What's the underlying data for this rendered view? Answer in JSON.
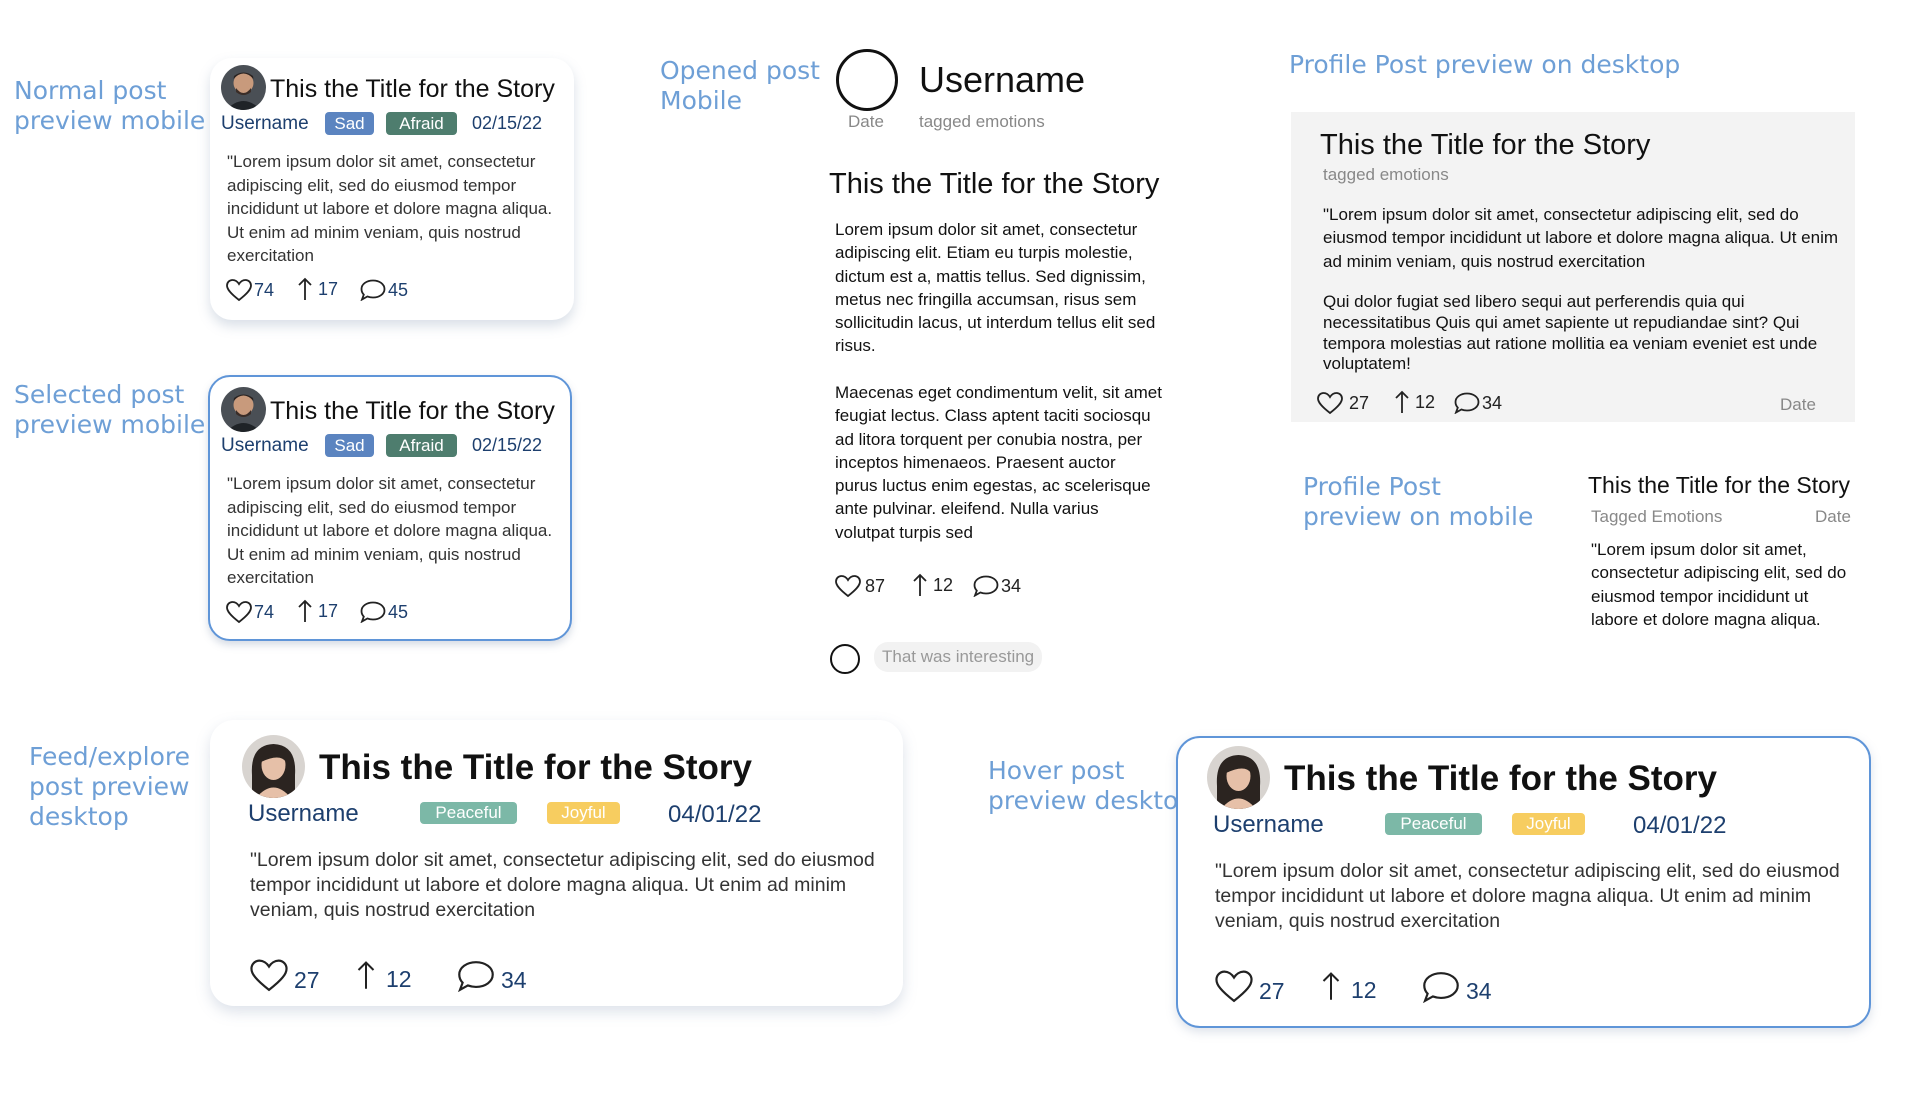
{
  "labels": {
    "normal": [
      "Normal post",
      "preview mobile"
    ],
    "selected": [
      "Selected post",
      "preview mobile"
    ],
    "feed": [
      "Feed/explore",
      "post preview",
      "desktop"
    ],
    "opened": [
      "Opened post",
      "Mobile"
    ],
    "profile_desktop": "Profile Post preview on desktop",
    "profile_mobile": [
      "Profile Post",
      "preview on mobile"
    ],
    "hover": [
      "Hover post",
      "preview desktop"
    ]
  },
  "mobile_post": {
    "title": "This the Title for the Story",
    "username": "Username",
    "tags": [
      "Sad",
      "Afraid"
    ],
    "date": "02/15/22",
    "body": "\"Lorem ipsum dolor sit amet, consectetur adipiscing elit, sed do eiusmod tempor incididunt ut labore et dolore magna aliqua. Ut enim ad minim veniam, quis nostrud exercitation",
    "likes": "74",
    "shares": "17",
    "comments": "45"
  },
  "desktop_post": {
    "title": "This the Title for the Story",
    "username": "Username",
    "tags": [
      "Peaceful",
      "Joyful"
    ],
    "date": "04/01/22",
    "body": "\"Lorem ipsum dolor sit amet, consectetur adipiscing elit, sed do eiusmod tempor incididunt ut labore et dolore magna aliqua. Ut enim ad minim veniam, quis nostrud exercitation",
    "likes": "27",
    "shares": "12",
    "comments": "34"
  },
  "opened_post": {
    "username": "Username",
    "date": "Date",
    "tagged": "tagged emotions",
    "title": "This the Title for the Story",
    "para1": "Lorem ipsum dolor sit amet, consectetur adipiscing elit. Etiam eu turpis molestie, dictum est a, mattis tellus. Sed dignissim, metus nec fringilla accumsan, risus sem sollicitudin lacus, ut interdum tellus elit sed risus.",
    "para2": "Maecenas eget condimentum velit, sit amet feugiat lectus. Class aptent taciti sociosqu ad litora torquent per conubia nostra, per inceptos himenaeos. Praesent auctor purus luctus enim egestas, ac scelerisque ante pulvinar. eleifend. Nulla varius volutpat turpis sed",
    "likes": "87",
    "shares": "12",
    "comments": "34",
    "comment_text": "That was interesting"
  },
  "profile_desktop": {
    "title": "This the Title for the Story",
    "tagged": "tagged emotions",
    "para1": "\"Lorem ipsum dolor sit amet, consectetur adipiscing elit, sed do eiusmod tempor incididunt ut labore et dolore magna aliqua. Ut enim ad minim veniam, quis nostrud exercitation",
    "para2": "Qui dolor fugiat sed libero sequi aut perferendis quia qui necessitatibus Quis qui amet sapiente ut repudiandae sint? Qui tempora molestias aut ratione mollitia ea veniam eveniet est unde voluptatem!",
    "likes": "27",
    "shares": "12",
    "comments": "34",
    "date": "Date"
  },
  "profile_mobile": {
    "title": "This the Title for the Story",
    "tagged": "Tagged Emotions",
    "date": "Date",
    "body": "\"Lorem ipsum dolor sit amet, consectetur adipiscing elit, sed do eiusmod tempor incididunt ut labore et dolore magna aliqua."
  },
  "colors": {
    "label_blue": "#6e9fd6",
    "dark_blue": "#1d3f6e",
    "tag_sad": "#5b84c0",
    "tag_afraid": "#4e7d6e",
    "tag_peaceful": "#7cb8a7",
    "tag_joyful": "#f7cd60",
    "selected_border": "#5f95d8"
  }
}
